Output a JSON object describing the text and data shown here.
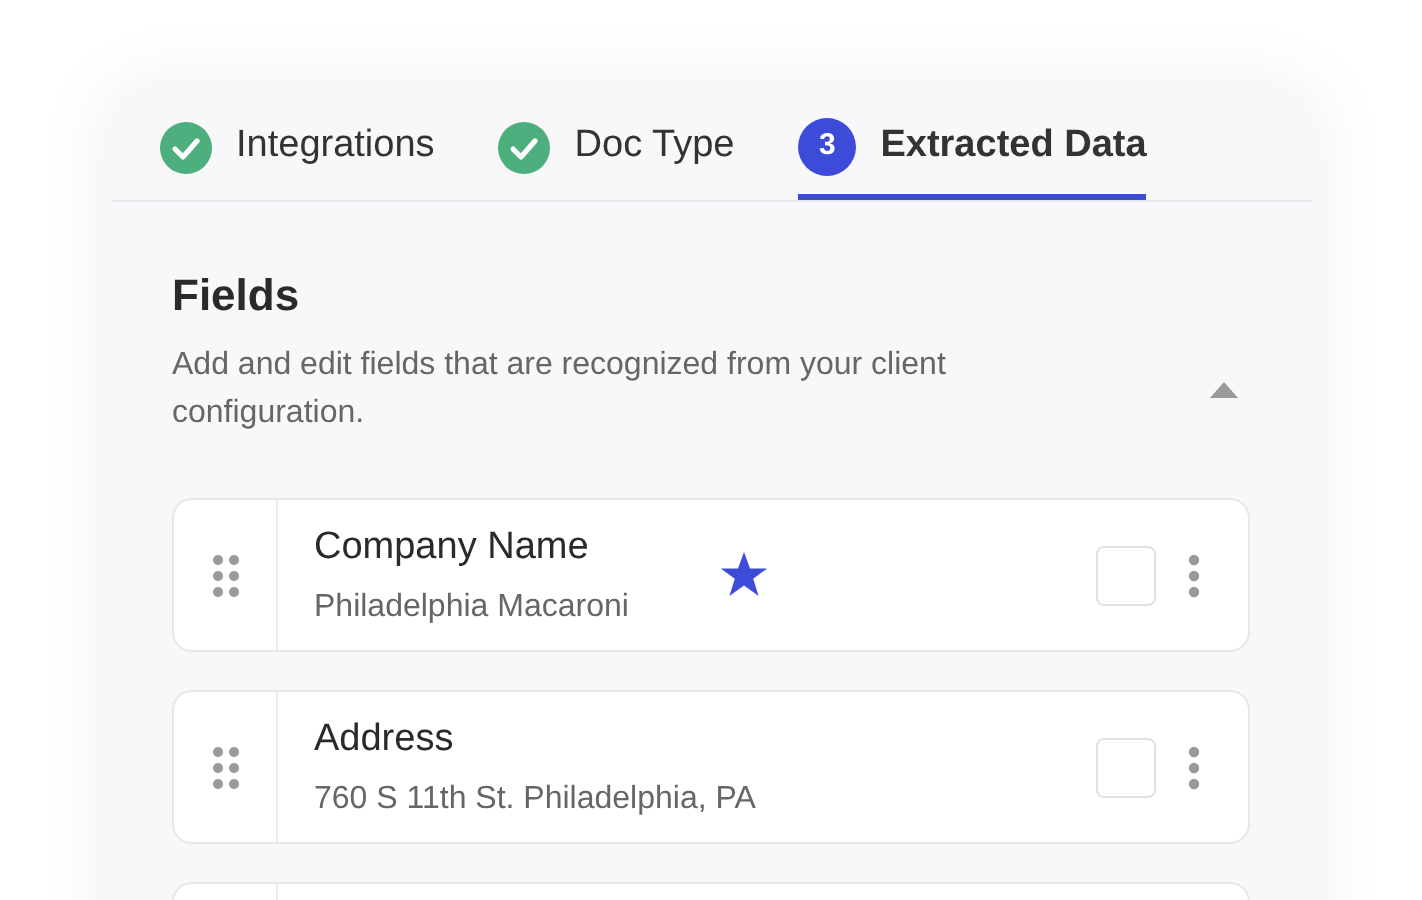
{
  "tabs": [
    {
      "label": "Integrations",
      "kind": "done",
      "selected": false
    },
    {
      "label": "Doc Type",
      "kind": "done",
      "selected": false
    },
    {
      "label": "Extracted Data",
      "kind": "step",
      "number": "3",
      "selected": true
    }
  ],
  "section": {
    "title": "Fields",
    "description": "Add and edit fields that are recognized from your client configuration.",
    "expanded": true
  },
  "fields": [
    {
      "name": "Company Name",
      "value": "Philadelphia Macaroni",
      "starred": true,
      "checked": false
    },
    {
      "name": "Address",
      "value": "760 S 11th St. Philadelphia, PA",
      "starred": false,
      "checked": false
    }
  ]
}
